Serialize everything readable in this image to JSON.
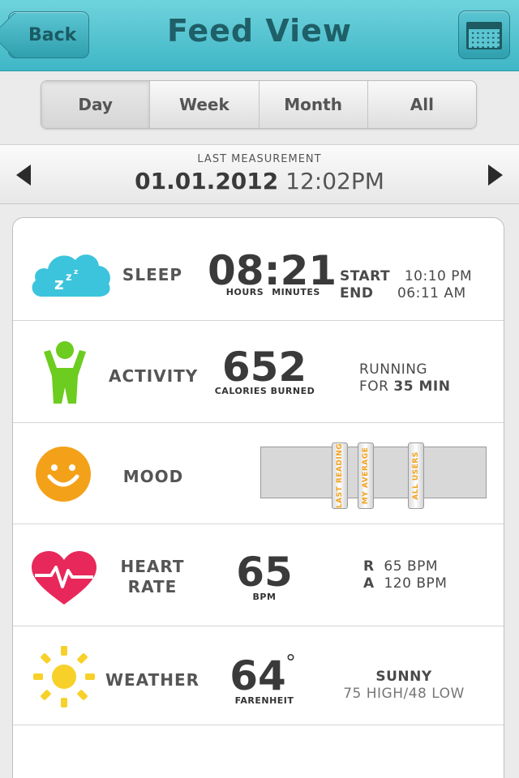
{
  "header": {
    "title": "Feed View",
    "back_label": "Back",
    "calendar_icon": "calendar-icon"
  },
  "tabs": [
    {
      "label": "Day",
      "selected": true
    },
    {
      "label": "Week",
      "selected": false
    },
    {
      "label": "Month",
      "selected": false
    },
    {
      "label": "All",
      "selected": false
    }
  ],
  "measurement": {
    "label": "LAST MEASUREMENT",
    "date": "01.01.2012",
    "time": "12:02PM"
  },
  "sleep": {
    "label": "SLEEP",
    "value": "08:21",
    "unit_hours": "HOURS",
    "unit_minutes": "MINUTES",
    "start_label": "START",
    "start_value": "10:10 PM",
    "end_label": "END",
    "end_value": "06:11 AM",
    "icon": "cloud-sleep-icon",
    "color": "#3cc4dc"
  },
  "activity": {
    "label": "ACTIVITY",
    "value": "652",
    "unit": "CALORIES BURNED",
    "line1": "RUNNING",
    "line2_prefix": "FOR",
    "line2_value": "35 MIN",
    "icon": "person-icon",
    "color": "#6ccc1f"
  },
  "mood": {
    "label": "MOOD",
    "icon": "smiley-icon",
    "color": "#f4a11a",
    "markers": [
      "LAST READING",
      "MY AVERAGE",
      "ALL USERS"
    ]
  },
  "heart": {
    "label_line1": "HEART",
    "label_line2": "RATE",
    "value": "65",
    "unit": "BPM",
    "r_label": "R",
    "r_value": "65 BPM",
    "a_label": "A",
    "a_value": "120 BPM",
    "icon": "heart-pulse-icon",
    "color": "#e8285a"
  },
  "weather": {
    "label": "WEATHER",
    "value": "64",
    "degree": "°",
    "unit": "FARENHEIT",
    "condition": "SUNNY",
    "range": "75 HIGH/48 LOW",
    "icon": "sun-icon",
    "color": "#f7d12a"
  }
}
